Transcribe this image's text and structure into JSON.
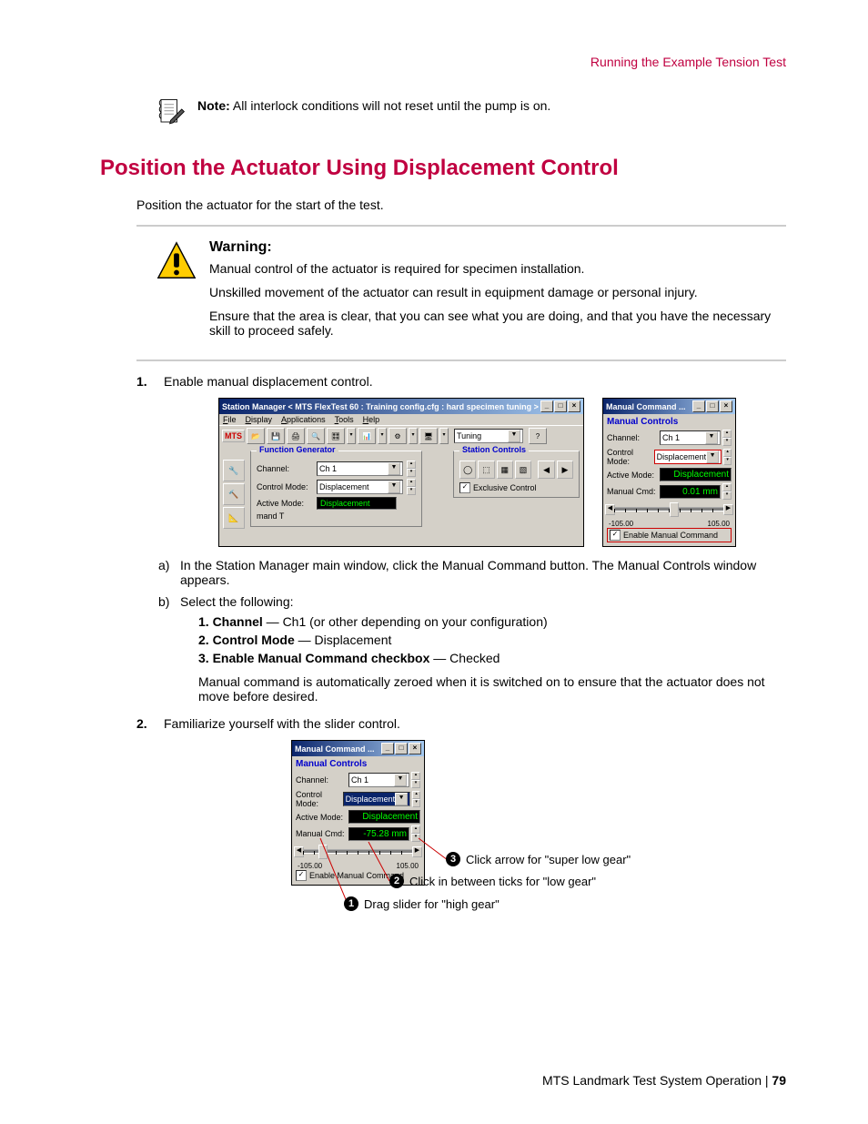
{
  "header_link": "Running the Example Tension Test",
  "note": {
    "label": "Note:",
    "text": " All interlock conditions will not reset until the pump is on."
  },
  "heading": "Position the Actuator Using Displacement Control",
  "intro": "Position the actuator for the start of the test.",
  "warning": {
    "title": "Warning:",
    "p1": "Manual control of the actuator is required for specimen installation.",
    "p2": "Unskilled movement of the actuator can result in equipment damage or personal injury.",
    "p3": "Ensure that the area is clear, that you can see what you are doing, and that you have the necessary skill to proceed safely."
  },
  "step1": {
    "num": "1.",
    "text": "Enable manual displacement control."
  },
  "sm": {
    "title": "Station Manager < MTS FlexTest 60 : Training config.cfg : hard specimen tuning >",
    "menu": {
      "file": "File",
      "display": "Display",
      "apps": "Applications",
      "tools": "Tools",
      "help": "Help"
    },
    "tuning": "Tuning",
    "fg_legend": "Function Generator",
    "sc_legend": "Station Controls",
    "channel_label": "Channel:",
    "channel_value": "Ch 1",
    "ctrlmode_label": "Control Mode:",
    "ctrlmode_value": "Displacement",
    "active_label": "Active Mode:",
    "active_value": "Displacement",
    "exclusive": "Exclusive Control",
    "mand": "mand T"
  },
  "mc1": {
    "title": "Manual Command ...",
    "legend": "Manual Controls",
    "channel_label": "Channel:",
    "channel_value": "Ch 1",
    "ctrlmode_label": "Control Mode:",
    "ctrlmode_value": "Displacement",
    "active_label": "Active Mode:",
    "active_value": "Displacement",
    "cmd_label": "Manual Cmd:",
    "cmd_value": "0.01  mm",
    "min": "-105.00",
    "max": "105.00",
    "enable": "Enable Manual Command"
  },
  "sub_a": {
    "m": "a)",
    "text": "In the Station Manager main window, click the Manual Command button. The Manual Controls window appears."
  },
  "sub_b": {
    "m": "b)",
    "text": "Select the following:",
    "i1_b": "1.  Channel",
    "i1_t": " — Ch1 (or other depending on your configuration)",
    "i2_b": "2.  Control Mode",
    "i2_t": " — Displacement",
    "i3_b": "3.  Enable Manual Command checkbox",
    "i3_t": " — Checked",
    "note": "Manual command is automatically zeroed when it is switched on to ensure that the actuator does not move before desired."
  },
  "step2": {
    "num": "2.",
    "text": "Familiarize yourself with the slider control."
  },
  "mc2": {
    "title": "Manual Command ...",
    "legend": "Manual Controls",
    "channel_label": "Channel:",
    "channel_value": "Ch 1",
    "ctrlmode_label": "Control Mode:",
    "ctrlmode_value": "Displacement",
    "active_label": "Active Mode:",
    "active_value": "Displacement",
    "cmd_label": "Manual Cmd:",
    "cmd_value": "-75.28  mm",
    "min": "-105.00",
    "max": "105.00",
    "enable": "Enable Manual Command"
  },
  "callouts": {
    "c3_num": "3",
    "c3_text": "Click arrow for \"super low gear\"",
    "c2_num": "2",
    "c2_text": "Click in between ticks for \"low gear\"",
    "c1_num": "1",
    "c1_text": "Drag slider for \"high gear\""
  },
  "footer": {
    "text": "MTS Landmark Test System Operation | ",
    "page": "79"
  }
}
